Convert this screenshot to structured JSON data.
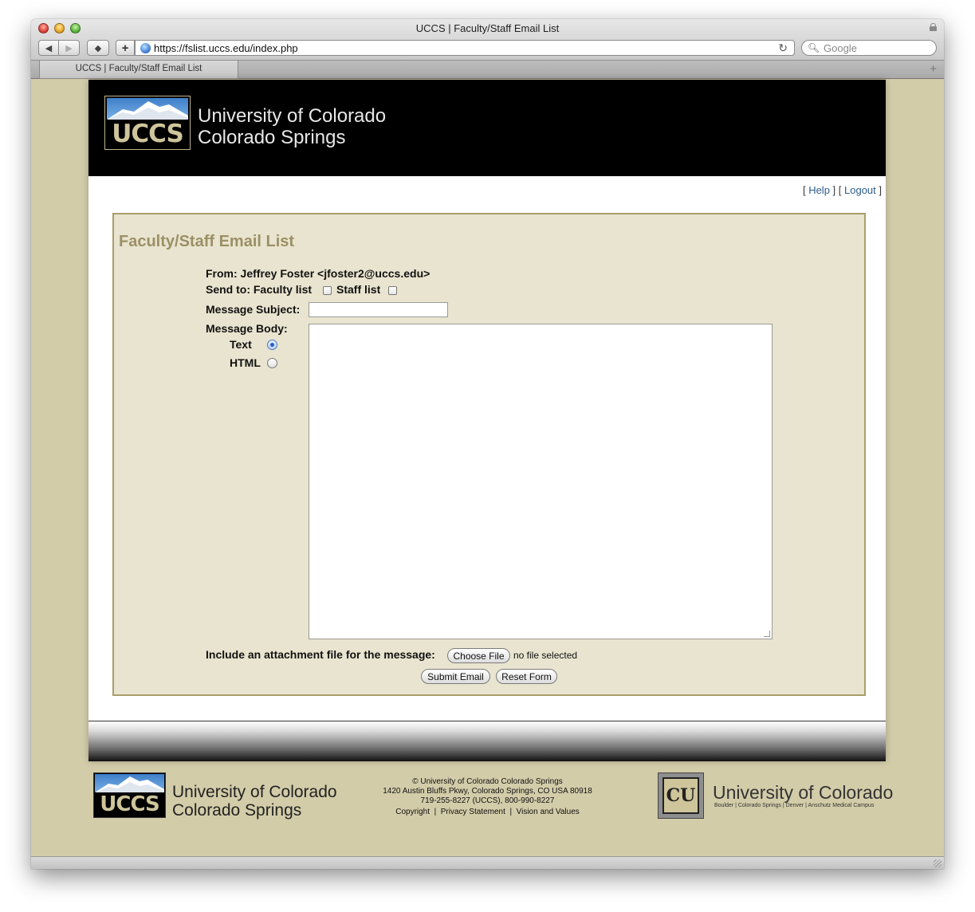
{
  "window": {
    "title": "UCCS | Faculty/Staff Email List",
    "url": "https://fslist.uccs.edu/index.php",
    "search_placeholder": "Google",
    "tab_label": "UCCS | Faculty/Staff Email List"
  },
  "header": {
    "logo_text": "UCCS",
    "name_line1": "University of Colorado",
    "name_line2": "Colorado Springs"
  },
  "top_links": {
    "help": "Help",
    "logout": "Logout"
  },
  "form": {
    "title": "Faculty/Staff Email List",
    "from_label": "From: Jeffrey Foster <jfoster2@uccs.edu>",
    "send_to_label": "Send to: Faculty list",
    "staff_list_label": "Staff list",
    "subject_label": "Message Subject:",
    "subject_value": "",
    "body_label": "Message Body:",
    "format_text_label": "Text",
    "format_html_label": "HTML",
    "selected_format": "Text",
    "body_value": "",
    "attachment_label": "Include an attachment file for the message:",
    "choose_file_label": "Choose File",
    "no_file_text": "no file selected",
    "submit_label": "Submit Email",
    "reset_label": "Reset Form"
  },
  "footer": {
    "logo_text": "UCCS",
    "name_line1": "University of Colorado",
    "name_line2": "Colorado Springs",
    "copyright": "© University of Colorado Colorado Springs",
    "address": "1420 Austin Bluffs Pkwy, Colorado Springs, CO USA 80918",
    "phone": "719-255-8227 (UCCS), 800-990-8227",
    "link_copyright": "Copyright",
    "link_privacy": "Privacy Statement",
    "link_vision": "Vision and Values",
    "cu_logo_text": "CU",
    "cu_name": "University of Colorado",
    "cu_campuses": "Boulder | Colorado Springs | Denver | Anschutz Medical Campus"
  }
}
